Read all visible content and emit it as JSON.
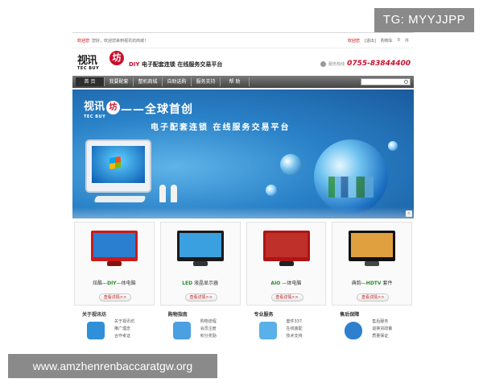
{
  "overlay": {
    "tg_code": "TG: MYYJJPP",
    "watermark_url": "www.amzhenrenbaccaratgw.org"
  },
  "topbar": {
    "greeting_name": "欢迎您",
    "greeting_text": "您好，欢迎您来到视讯坊商城！",
    "links": [
      "欢迎您",
      "[退出]",
      "购物车",
      "0",
      "件"
    ]
  },
  "header": {
    "logo_cn": "视讯",
    "logo_badge": "坊",
    "logo_en": "TEC BUY",
    "slogan_diy": "DIY",
    "slogan": "电子配套连锁  在线服务交易平台",
    "hotline_label": "服务热线",
    "hotline_number": "0755-83844400"
  },
  "nav": {
    "items": [
      "首 页",
      "我要配套",
      "整机商城",
      "自助选购",
      "服务支持",
      "帮 助"
    ],
    "active_index": 0
  },
  "banner": {
    "logo_cn": "视讯",
    "logo_badge": "坊",
    "logo_en": "TEC BUY",
    "headline": "——全球首创",
    "subline": "电子配套连锁  在线服务交易平台",
    "next_arrow": "›"
  },
  "products": [
    {
      "prefix": "炫酷—",
      "highlight": "DIY",
      "suffix": "—体电脑",
      "button": "查看详情>>",
      "bezel": "#c81c1c",
      "screen": "#2a7fd0",
      "stand": "#8a1010"
    },
    {
      "prefix": "",
      "highlight": "LED",
      "suffix": " 液晶显示器",
      "button": "查看详情>>",
      "bezel": "#1a1a1a",
      "screen": "#3aa0e0",
      "stand": "#333333"
    },
    {
      "prefix": "",
      "highlight": "AIO",
      "suffix": " —体电脑",
      "button": "查看详情>>",
      "bezel": "#b01414",
      "screen": "#c0302a",
      "stand": "#222222"
    },
    {
      "prefix": "典韵—",
      "highlight": "HDTV",
      "suffix": " 套件",
      "button": "查看详情>>",
      "bezel": "#111111",
      "screen": "#e0a040",
      "stand": "#444444"
    }
  ],
  "info": [
    {
      "heading": "关于视讯坊",
      "icon_color": "#2f8fd8",
      "links": [
        "关于视讯坊",
        "推广理念",
        "合作考证"
      ]
    },
    {
      "heading": "购物指南",
      "icon_color": "#4aa0e0",
      "links": [
        "购物流程",
        "会员注册",
        "积分奖励"
      ]
    },
    {
      "heading": "专业服务",
      "icon_color": "#5ab0e8",
      "links": [
        "套件337",
        "在线装配",
        "技术支持"
      ]
    },
    {
      "heading": "售后保障",
      "icon_color": "#2f7fcf",
      "links": [
        "售后服务",
        "退换货政策",
        "质量保证"
      ]
    }
  ],
  "colors": {
    "brand_red": "#c8102e",
    "nav_dark": "#444444",
    "accent_blue": "#2a82c8"
  }
}
